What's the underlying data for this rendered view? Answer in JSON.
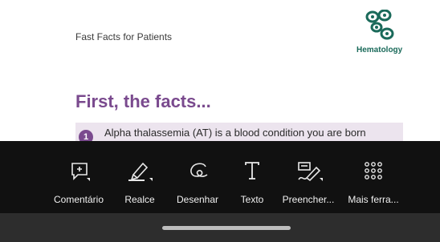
{
  "document": {
    "header": "Fast Facts for Patients",
    "logo_text": "Hematology",
    "heading": "First, the facts...",
    "fact": {
      "number": "1",
      "text": "Alpha thalassemia (AT) is a blood condition you are born"
    }
  },
  "toolbar": {
    "tools": [
      {
        "label": "Comentário",
        "icon": "comment-icon"
      },
      {
        "label": "Realce",
        "icon": "highlighter-icon"
      },
      {
        "label": "Desenhar",
        "icon": "draw-icon"
      },
      {
        "label": "Texto",
        "icon": "text-icon"
      },
      {
        "label": "Preencher...",
        "icon": "fill-sign-icon"
      },
      {
        "label": "Mais ferra...",
        "icon": "more-tools-icon"
      }
    ]
  },
  "colors": {
    "accent": "#7a4a8e",
    "logo": "#1a6a5a",
    "toolbar_bg": "#111111"
  }
}
